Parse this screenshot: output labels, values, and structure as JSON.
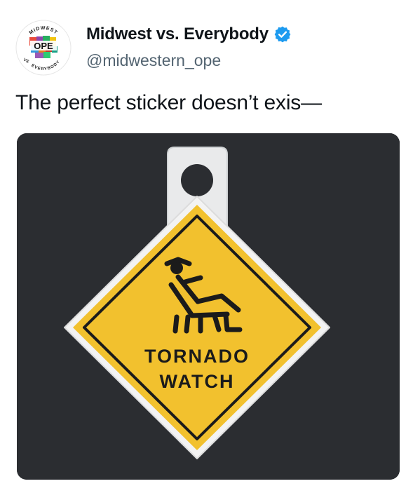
{
  "account": {
    "display_name": "Midwest vs. Everybody",
    "handle": "@midwestern_ope",
    "verified": true,
    "avatar": {
      "top_text": "MIDWEST",
      "center_text": "OPE",
      "bottom_text": "EVERYBODY",
      "left_text": "VS"
    }
  },
  "tweet": {
    "text": "The perfect sticker doesn’t exis—"
  },
  "media": {
    "sticker_text_line1": "TORNADO",
    "sticker_text_line2": "WATCH",
    "sign_color": "#f2c12e",
    "background_color": "#2b2d31"
  },
  "colors": {
    "verified_badge": "#1d9bf0",
    "handle_text": "#536471"
  }
}
